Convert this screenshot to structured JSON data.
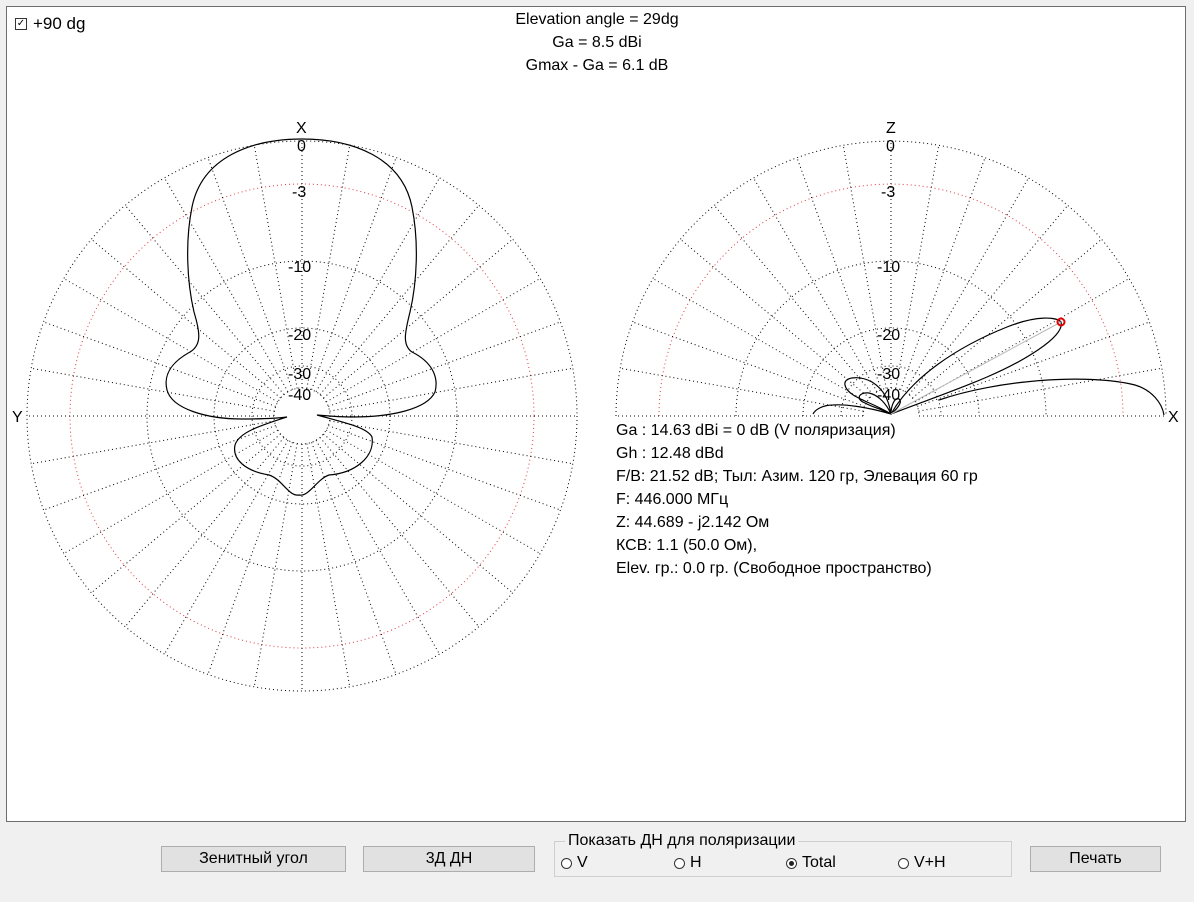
{
  "options": {
    "plus90_label": "+90 dg",
    "plus90_checked": true
  },
  "header": {
    "elevation": "Elevation angle =  29dg",
    "ga": "Ga = 8.5 dBi",
    "gmax": "Gmax - Ga = 6.1 dB"
  },
  "azimuth_plot": {
    "top_axis": "X",
    "left_axis": "Y"
  },
  "elevation_plot": {
    "top_axis": "Z",
    "right_axis": "X"
  },
  "db_ticks": [
    "0",
    "-3",
    "-10",
    "-20",
    "-30",
    "-40"
  ],
  "info": {
    "ga": "Ga : 14.63 dBi = 0 dB  (V поляризация)",
    "gh": "Gh : 12.48 dBd",
    "fb": "F/B: 21.52 dB; Тыл: Азим. 120 гр, Элевация 60 гр",
    "freq": "F: 446.000 МГц",
    "z": "Z: 44.689 - j2.142 Ом",
    "swr": "КСВ: 1.1 (50.0 Ом),",
    "elev": "Elev. гр.: 0.0 гр. (Свободное пространство)"
  },
  "buttons": {
    "zenith": "Зенитный угол",
    "three_d": "3Д   ДН",
    "print": "Печать"
  },
  "polarization": {
    "legend": "Показать ДН для поляризации",
    "options": [
      "V",
      "H",
      "Total",
      "V+H"
    ],
    "selected": "Total"
  },
  "colors": {
    "grid": "#000000",
    "ref_circle": "#e0383f",
    "marker": "#e00000",
    "pattern": "#000000"
  }
}
